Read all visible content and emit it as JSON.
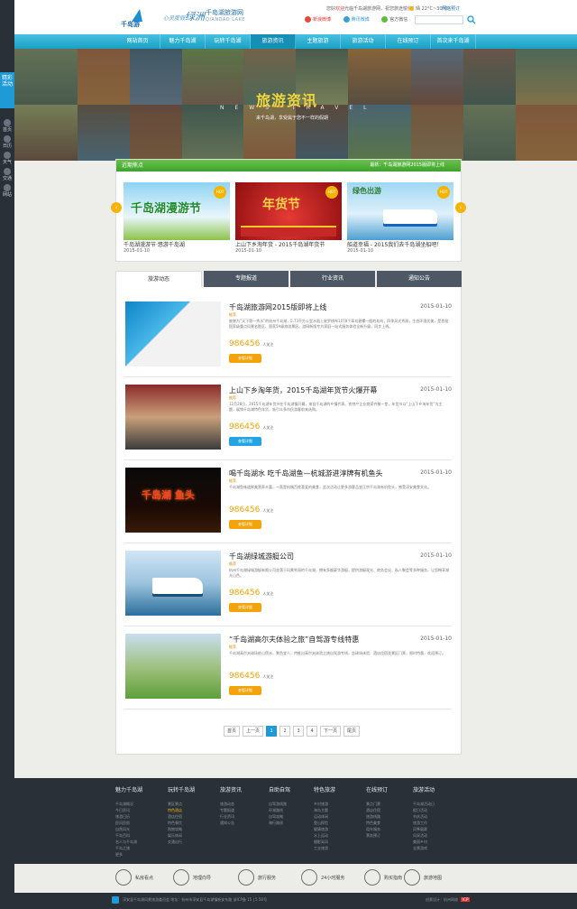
{
  "colors": {
    "accent": "#1e9ad6",
    "nav": "#2aaed0",
    "focus_bar": "#4fb23a",
    "price": "#f0a300",
    "dark": "#2a3038"
  },
  "sidebar": {
    "tab_label": "精彩活动",
    "items": [
      {
        "label": "首页",
        "icon": "home-icon"
      },
      {
        "label": "日历",
        "icon": "calendar-icon"
      },
      {
        "label": "天气",
        "icon": "weather-icon"
      },
      {
        "label": "交通",
        "icon": "traffic-icon"
      },
      {
        "label": "网站",
        "icon": "globe-icon"
      }
    ]
  },
  "header": {
    "logo_text": "千岛游",
    "slogan": "心灵度假",
    "slogan_script": "绿洲",
    "site_name": "千岛湖旅游网",
    "site_name_en": "QIANDAO LAKE",
    "top_welcome_pre": "您好",
    "top_welcome_hl": "欢迎",
    "top_welcome_post": "光临千岛湖旅游网，祝您旅途愉快！",
    "weather": "晴 22°C~30°C",
    "ticket_link": "网络预订",
    "weibo": "新浪微博",
    "tencent": "腾讯微博",
    "wechat": "官方微信",
    "search_placeholder": ""
  },
  "nav": {
    "items": [
      "网站首页",
      "魅力千岛湖",
      "玩转千岛湖",
      "旅游资讯",
      "主题旅游",
      "旅游活动",
      "在线预订",
      "首次来千岛湖"
    ],
    "active_index": 3
  },
  "banner": {
    "title": "旅游资讯",
    "title_en": "NEWS·TRAVEL",
    "subtitle": "来千岛湖，享受属于您不一样的假期"
  },
  "focus": {
    "title": "近期焦点",
    "ticker": "最新：千岛湖旅游网2015版即将上线",
    "prev_label": "‹",
    "next_label": "›",
    "cards": [
      {
        "caption": "千岛湖漫游节·悠游千岛湖",
        "date": "2015-01-10",
        "img_text": "千岛湖漫游节"
      },
      {
        "caption": "上山下乡淘年货 - 2015千岛湖年货节",
        "date": "2015-01-10",
        "img_text": "年货节"
      },
      {
        "caption": "船道幸福 - 2015我们去千岛湖坐船吧！",
        "date": "2015-01-10",
        "img_text": "绿色出游"
      }
    ]
  },
  "tabs": {
    "items": [
      "旅游动态",
      "专题报道",
      "行业资讯",
      "通知公告"
    ],
    "active_index": 0
  },
  "news": [
    {
      "title": "千岛湖旅游网2015版即将上线",
      "date": "2015-01-10",
      "tag": "推荐",
      "desc": "被誉为“天下第一秀水”的杭州千岛湖，5.73平方公里水面上星罗棋布1078个翠岛碧螺一般的岛屿，四季风光秀丽，生态环境优美，是首批国家级重点风景名胜区、国家5A级旅游景区。游网新版专为家庭一站式服务体验全新升级，同步上线。",
      "count": "986456",
      "count_label": "人关注",
      "button": "查看详细"
    },
    {
      "title": "上山下乡淘年货，2015千岛湖年货节火爆开幕",
      "date": "2015-01-10",
      "tag": "推荐",
      "desc": "12月28日，2015千岛湖年货节在千岛湖镇开幕，来自千岛湖的乡镇代表、农特产企业商家齐聚一堂，年货节以“上山下乡淘年货”为主题，展销千岛湖特色年货，吸引众多市民游客前来选购。",
      "count": "986456",
      "count_label": "人关注",
      "button": "查看详细"
    },
    {
      "title": "喝千岛湖水 吃千岛湖鱼—杭城游进淳牌有机鱼头",
      "date": "2015-01-10",
      "tag": "推荐",
      "desc": "千岛湖鱼味道鲜美营养丰富，一直是杭城百姓喜爱的美食，此次活动让更多游客品尝正宗千岛湖有机鱼头，感受淳安美食文化。",
      "count": "986456",
      "count_label": "人关注",
      "button": "查看详细"
    },
    {
      "title": "千岛湖绿城游艇公司",
      "date": "2015-01-10",
      "tag": "推荐",
      "desc": "杭州千岛湖绿城游艇有限公司坐落于风景秀丽的千岛湖，拥有多艘豪华游艇，提供游艇观光、商务会议、私人聚会等多种服务，让您畅享湖光山色。",
      "count": "986456",
      "count_label": "人关注",
      "button": "查看详细"
    },
    {
      "title": "“千岛湖高尔夫体验之旅”自驾游专线特惠",
      "date": "2015-01-10",
      "tag": "推荐",
      "desc": "千岛湖高尔夫球场依山傍水，景色宜人，特推出高尔夫体验之旅自驾游专线，含球场体验、酒店住宿及景区门票，限时特惠，欢迎预订。",
      "count": "986456",
      "count_label": "人关注",
      "button": "查看详细"
    }
  ],
  "pager": {
    "items": [
      "首页",
      "上一页",
      "1",
      "2",
      "3",
      "4",
      "下一页",
      "尾页"
    ],
    "active": "1"
  },
  "footer": {
    "cols": [
      {
        "heading": "魅力千岛湖",
        "links": [
          "千岛湖概况",
          "今日资讯",
          "旅游日历",
          "民风民俗",
          "自然风光",
          "千岛百科",
          "名人与千岛湖",
          "千岛之旅",
          "更多"
        ]
      },
      {
        "heading": "玩转千岛湖",
        "links": [
          "景区景点",
          "特色酒店",
          "酒店住宿",
          "特色餐饮",
          "购物攻略",
          "娱乐休闲",
          "交通出行"
        ]
      },
      {
        "heading": "旅游资讯",
        "links": [
          "旅游动态",
          "专题报道",
          "行业资讯",
          "通知公告"
        ]
      },
      {
        "heading": "自助自驾",
        "links": [
          "自驾游线路",
          "环湖路线",
          "自驾攻略",
          "骑行路线"
        ]
      },
      {
        "heading": "特色旅游",
        "links": [
          "乡村旅游",
          "海岛主题",
          "运动休闲",
          "登山探险",
          "健康旅游",
          "水上运动",
          "摄影采风",
          "工业旅游"
        ]
      },
      {
        "heading": "在线预订",
        "links": [
          "景点门票",
          "酒店住宿",
          "旅游线路",
          "特色美食",
          "租车服务",
          "票务预订"
        ]
      },
      {
        "heading": "旅游活动",
        "links": [
          "千岛湖活动日",
          "假日活动",
          "节庆活动",
          "旅游工作",
          "风筝展赛",
          "风采活动",
          "美丽乡村",
          "全景游戏"
        ]
      }
    ]
  },
  "services": [
    {
      "label": "私房看点",
      "icon": "photo-icon"
    },
    {
      "label": "地理向导",
      "icon": "dining-icon"
    },
    {
      "label": "旅行服务",
      "icon": "compass-icon"
    },
    {
      "label": "24小时服务",
      "icon": "clock-24-icon"
    },
    {
      "label": "购买指南",
      "icon": "cart-icon"
    },
    {
      "label": "旅游地图",
      "icon": "map-icon"
    }
  ],
  "bottom": {
    "copyright": "淳安县千岛湖风景旅游委员会 地址：杭州市淳安县千岛湖镇新安东路 浙ICP备 15 | 5 50号",
    "credit": "创意设计：杭州网络",
    "badge": "ICP"
  }
}
